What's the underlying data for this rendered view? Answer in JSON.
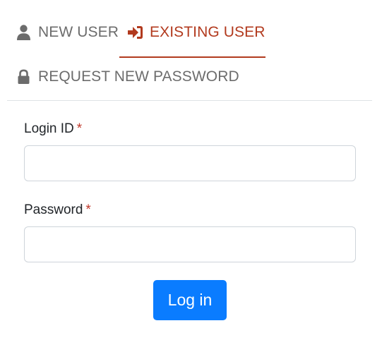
{
  "tabs": {
    "new_user": {
      "label": "NEW USER",
      "icon": "user-icon"
    },
    "existing_user": {
      "label": "EXISTING USER",
      "icon": "sign-in-icon",
      "active": true
    },
    "request_password": {
      "label": "REQUEST NEW PASSWORD",
      "icon": "lock-icon"
    }
  },
  "form": {
    "login_id": {
      "label": "Login ID",
      "required_marker": "*",
      "value": ""
    },
    "password": {
      "label": "Password",
      "required_marker": "*",
      "value": ""
    },
    "submit_label": "Log in"
  },
  "colors": {
    "accent": "#b23a1e",
    "inactive_tab": "#6c6c6c",
    "required": "#c0392b",
    "button": "#0a7cff"
  }
}
